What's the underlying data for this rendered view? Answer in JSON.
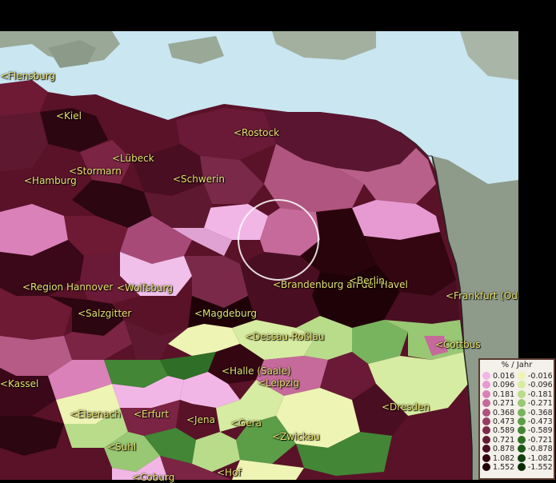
{
  "map": {
    "cities": [
      {
        "label": "<Flensburg"
      },
      {
        "label": "<Kiel"
      },
      {
        "label": "<Rostock"
      },
      {
        "label": "<Lübeck"
      },
      {
        "label": "<Stormarn"
      },
      {
        "label": "<Hamburg"
      },
      {
        "label": "<Schwerin"
      },
      {
        "label": "<Region Hannover"
      },
      {
        "label": "<Wolfsburg"
      },
      {
        "label": "<Brandenburg an der Havel"
      },
      {
        "label": "<Berlin"
      },
      {
        "label": "<Frankfurt (Oder)"
      },
      {
        "label": "<Salzgitter"
      },
      {
        "label": "<Magdeburg"
      },
      {
        "label": "<Dessau-Roßlau"
      },
      {
        "label": "<Cottbus"
      },
      {
        "label": "<Kassel"
      },
      {
        "label": "<Halle (Saale)"
      },
      {
        "label": "<Leipzig"
      },
      {
        "label": "<Dresden"
      },
      {
        "label": "<Eisenach"
      },
      {
        "label": "<Erfurt"
      },
      {
        "label": "<Jena"
      },
      {
        "label": "<Gera"
      },
      {
        "label": "<Zwickau"
      },
      {
        "label": "<Suhl"
      },
      {
        "label": "<Hof"
      },
      {
        "label": "<Coburg"
      }
    ]
  },
  "legend": {
    "title": "% / Jahr",
    "positive": [
      {
        "value": "0.016",
        "color": "#f2b6e6"
      },
      {
        "value": "0.096",
        "color": "#e79ad2"
      },
      {
        "value": "0.181",
        "color": "#d981b8"
      },
      {
        "value": "0.271",
        "color": "#c56a9a"
      },
      {
        "value": "0.368",
        "color": "#ae537e"
      },
      {
        "value": "0.473",
        "color": "#963d64"
      },
      {
        "value": "0.589",
        "color": "#7c2a4a"
      },
      {
        "value": "0.721",
        "color": "#631a34"
      },
      {
        "value": "0.878",
        "color": "#4a0e22"
      },
      {
        "value": "1.082",
        "color": "#330612"
      },
      {
        "value": "1.552",
        "color": "#1e0208"
      }
    ],
    "negative": [
      {
        "value": "-0.016",
        "color": "#eef4b4"
      },
      {
        "value": "-0.096",
        "color": "#d6eca2"
      },
      {
        "value": "-0.181",
        "color": "#b8dc8a"
      },
      {
        "value": "-0.271",
        "color": "#98c874"
      },
      {
        "value": "-0.368",
        "color": "#78b45e"
      },
      {
        "value": "-0.473",
        "color": "#5c9e48"
      },
      {
        "value": "-0.589",
        "color": "#428636"
      },
      {
        "value": "-0.721",
        "color": "#2e6e26"
      },
      {
        "value": "-0.878",
        "color": "#1e5618"
      },
      {
        "value": "-1.082",
        "color": "#12400e"
      },
      {
        "value": "-1.552",
        "color": "#0a2a06"
      }
    ]
  }
}
